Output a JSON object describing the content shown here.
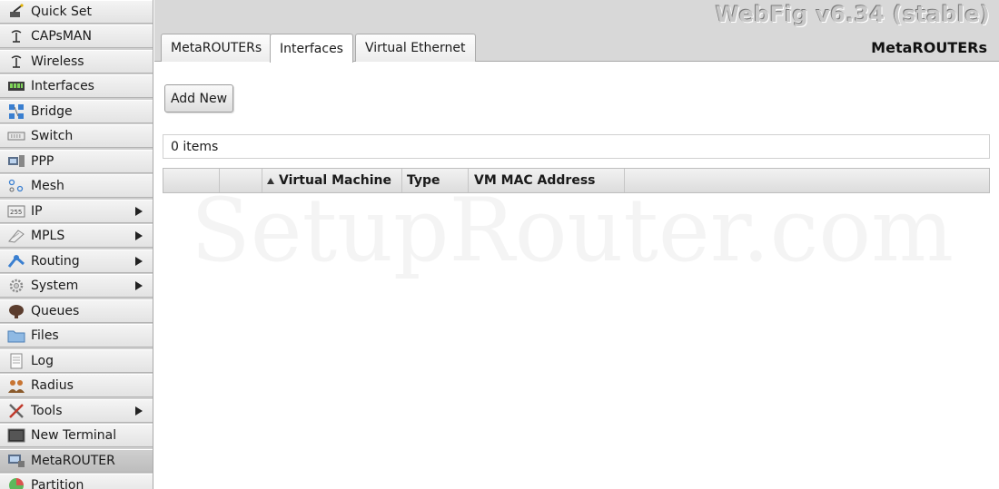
{
  "app": {
    "brand": "WebFig v6.34 (stable)",
    "section_title": "MetaROUTERs",
    "watermark": "SetupRouter.com"
  },
  "sidebar": {
    "items": [
      {
        "label": "Quick Set",
        "icon": "wand-icon",
        "submenu": false
      },
      {
        "label": "CAPsMAN",
        "icon": "antenna-icon",
        "submenu": false
      },
      {
        "label": "Wireless",
        "icon": "antenna-icon",
        "submenu": false
      },
      {
        "label": "Interfaces",
        "icon": "ports-icon",
        "submenu": false
      },
      {
        "label": "Bridge",
        "icon": "bridge-icon",
        "submenu": false
      },
      {
        "label": "Switch",
        "icon": "switch-icon",
        "submenu": false
      },
      {
        "label": "PPP",
        "icon": "ppp-icon",
        "submenu": false
      },
      {
        "label": "Mesh",
        "icon": "mesh-icon",
        "submenu": false
      },
      {
        "label": "IP",
        "icon": "ip-icon",
        "submenu": true
      },
      {
        "label": "MPLS",
        "icon": "mpls-icon",
        "submenu": true
      },
      {
        "label": "Routing",
        "icon": "routing-icon",
        "submenu": true
      },
      {
        "label": "System",
        "icon": "gear-icon",
        "submenu": true
      },
      {
        "label": "Queues",
        "icon": "queues-icon",
        "submenu": false
      },
      {
        "label": "Files",
        "icon": "folder-icon",
        "submenu": false
      },
      {
        "label": "Log",
        "icon": "log-icon",
        "submenu": false
      },
      {
        "label": "Radius",
        "icon": "radius-icon",
        "submenu": false
      },
      {
        "label": "Tools",
        "icon": "tools-icon",
        "submenu": true
      },
      {
        "label": "New Terminal",
        "icon": "terminal-icon",
        "submenu": false
      },
      {
        "label": "MetaROUTER",
        "icon": "metarouter-icon",
        "submenu": false,
        "active": true
      },
      {
        "label": "Partition",
        "icon": "partition-icon",
        "submenu": false
      }
    ]
  },
  "tabs": [
    {
      "label": "MetaROUTERs",
      "active": false
    },
    {
      "label": "Interfaces",
      "active": true
    },
    {
      "label": "Virtual Ethernet",
      "active": false
    }
  ],
  "toolbar": {
    "add_new_label": "Add New"
  },
  "list": {
    "count_text": "0 items",
    "columns": [
      "",
      "",
      "Virtual Machine",
      "Type",
      "VM MAC Address",
      ""
    ],
    "sorted_column": "Virtual Machine",
    "sort_direction": "ascending",
    "rows": []
  },
  "colors": {
    "sidebar_bg": "#e6e6e6",
    "header_bg": "#d8d8d8",
    "active_item_bg": "#c4c4c4"
  }
}
